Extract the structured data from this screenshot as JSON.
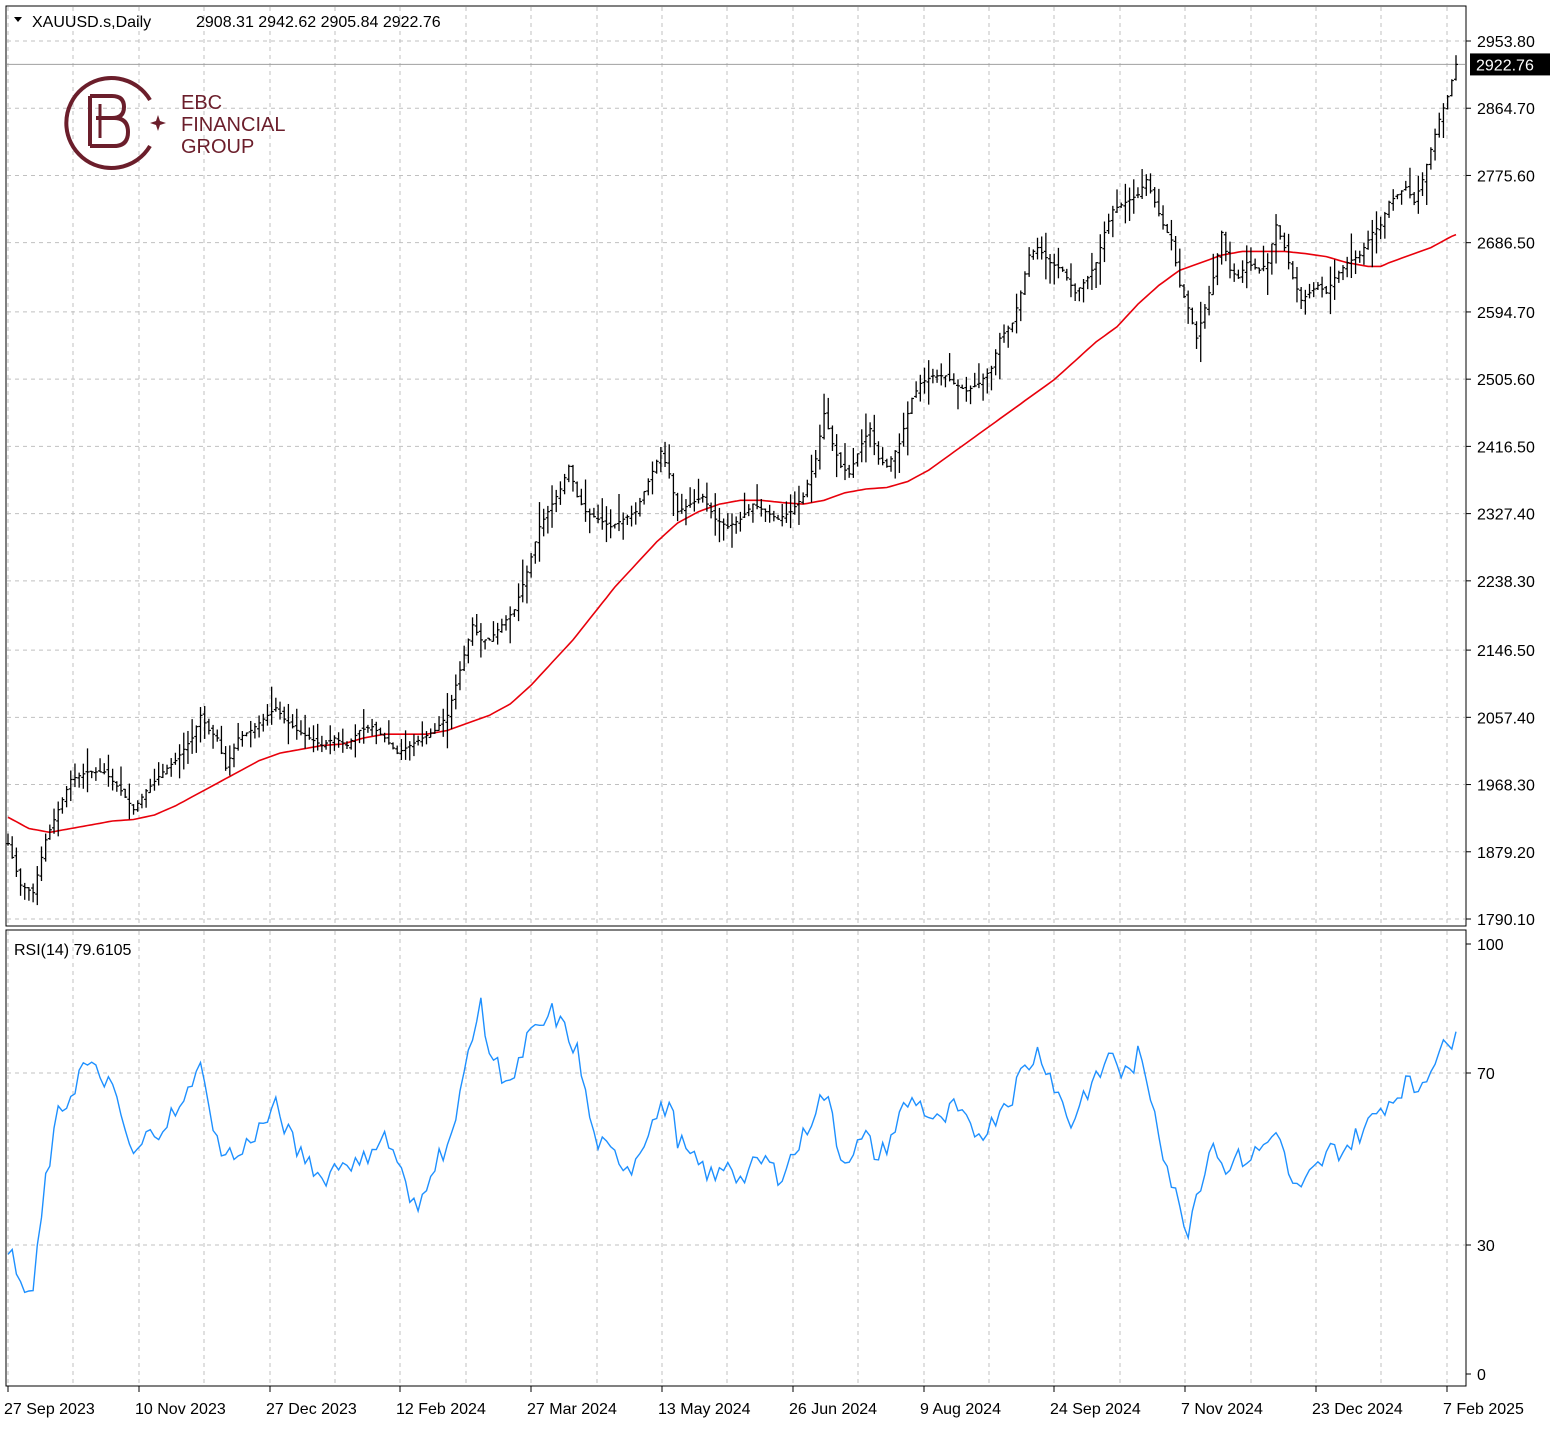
{
  "header": {
    "symbol": "XAUUSD.s,Daily",
    "ohlc": "2908.31 2942.62 2905.84 2922.76"
  },
  "logo": {
    "line1": "EBC",
    "line2": "FINANCIAL",
    "line3": "GROUP",
    "color": "#6b1e2b"
  },
  "indicator": {
    "label": "RSI(14) 79.6105"
  },
  "colors": {
    "candles": "#000000",
    "ma": "#e8000b",
    "rsi": "#1e90ff",
    "grid": "#c0c0c0",
    "last_price_bg": "#000000",
    "last_price_fg": "#ffffff"
  },
  "chart_data": [
    {
      "type": "bar",
      "title": "XAUUSD.s,Daily",
      "x_labels": [
        "27 Sep 2023",
        "10 Nov 2023",
        "27 Dec 2023",
        "12 Feb 2024",
        "27 Mar 2024",
        "13 May 2024",
        "26 Jun 2024",
        "9 Aug 2024",
        "24 Sep 2024",
        "7 Nov 2024",
        "23 Dec 2024",
        "7 Feb 2025"
      ],
      "y_ticks": [
        "2953.80",
        "2864.70",
        "2775.60",
        "2686.50",
        "2594.70",
        "2505.60",
        "2416.50",
        "2327.40",
        "2238.30",
        "2146.50",
        "2057.40",
        "1968.30",
        "1879.20",
        "1790.10"
      ],
      "ylim": [
        1790.1,
        2953.8
      ],
      "last_price": "2922.76",
      "close_series_anchors": [
        [
          0,
          1890
        ],
        [
          3,
          1835
        ],
        [
          6,
          1825
        ],
        [
          9,
          1895
        ],
        [
          12,
          1935
        ],
        [
          15,
          1975
        ],
        [
          19,
          1985
        ],
        [
          23,
          1985
        ],
        [
          27,
          1960
        ],
        [
          30,
          1935
        ],
        [
          33,
          1960
        ],
        [
          37,
          1985
        ],
        [
          40,
          2000
        ],
        [
          44,
          2030
        ],
        [
          46,
          2060
        ],
        [
          48,
          2040
        ],
        [
          50,
          2030
        ],
        [
          52,
          1990
        ],
        [
          55,
          2030
        ],
        [
          58,
          2040
        ],
        [
          62,
          2060
        ],
        [
          64,
          2070
        ],
        [
          66,
          2055
        ],
        [
          69,
          2040
        ],
        [
          72,
          2030
        ],
        [
          75,
          2020
        ],
        [
          78,
          2030
        ],
        [
          81,
          2020
        ],
        [
          84,
          2040
        ],
        [
          87,
          2045
        ],
        [
          90,
          2030
        ],
        [
          93,
          2010
        ],
        [
          96,
          2020
        ],
        [
          99,
          2030
        ],
        [
          102,
          2040
        ],
        [
          105,
          2060
        ],
        [
          108,
          2120
        ],
        [
          111,
          2180
        ],
        [
          113,
          2160
        ],
        [
          115,
          2160
        ],
        [
          118,
          2180
        ],
        [
          121,
          2200
        ],
        [
          124,
          2250
        ],
        [
          127,
          2310
        ],
        [
          129,
          2330
        ],
        [
          132,
          2360
        ],
        [
          134,
          2390
        ],
        [
          136,
          2350
        ],
        [
          138,
          2330
        ],
        [
          141,
          2320
        ],
        [
          144,
          2310
        ],
        [
          147,
          2320
        ],
        [
          150,
          2330
        ],
        [
          153,
          2370
        ],
        [
          156,
          2410
        ],
        [
          158,
          2380
        ],
        [
          160,
          2330
        ],
        [
          163,
          2340
        ],
        [
          166,
          2350
        ],
        [
          169,
          2320
        ],
        [
          172,
          2310
        ],
        [
          175,
          2320
        ],
        [
          178,
          2340
        ],
        [
          181,
          2330
        ],
        [
          184,
          2320
        ],
        [
          187,
          2330
        ],
        [
          190,
          2350
        ],
        [
          193,
          2400
        ],
        [
          195,
          2460
        ],
        [
          197,
          2420
        ],
        [
          199,
          2390
        ],
        [
          201,
          2380
        ],
        [
          204,
          2420
        ],
        [
          206,
          2440
        ],
        [
          208,
          2400
        ],
        [
          210,
          2390
        ],
        [
          213,
          2420
        ],
        [
          216,
          2480
        ],
        [
          218,
          2500
        ],
        [
          221,
          2510
        ],
        [
          224,
          2510
        ],
        [
          226,
          2500
        ],
        [
          229,
          2490
        ],
        [
          232,
          2500
        ],
        [
          235,
          2520
        ],
        [
          237,
          2560
        ],
        [
          240,
          2580
        ],
        [
          242,
          2620
        ],
        [
          244,
          2670
        ],
        [
          246,
          2680
        ],
        [
          249,
          2660
        ],
        [
          252,
          2650
        ],
        [
          255,
          2620
        ],
        [
          258,
          2640
        ],
        [
          260,
          2660
        ],
        [
          262,
          2700
        ],
        [
          264,
          2730
        ],
        [
          267,
          2740
        ],
        [
          270,
          2750
        ],
        [
          272,
          2770
        ],
        [
          274,
          2740
        ],
        [
          276,
          2710
        ],
        [
          278,
          2690
        ],
        [
          280,
          2630
        ],
        [
          282,
          2600
        ],
        [
          284,
          2560
        ],
        [
          286,
          2600
        ],
        [
          288,
          2640
        ],
        [
          290,
          2700
        ],
        [
          292,
          2650
        ],
        [
          294,
          2640
        ],
        [
          296,
          2660
        ],
        [
          299,
          2650
        ],
        [
          301,
          2660
        ],
        [
          303,
          2710
        ],
        [
          305,
          2680
        ],
        [
          307,
          2640
        ],
        [
          309,
          2610
        ],
        [
          311,
          2620
        ],
        [
          313,
          2630
        ],
        [
          315,
          2620
        ],
        [
          317,
          2640
        ],
        [
          320,
          2660
        ],
        [
          323,
          2670
        ],
        [
          326,
          2700
        ],
        [
          328,
          2710
        ],
        [
          330,
          2740
        ],
        [
          332,
          2750
        ],
        [
          334,
          2760
        ],
        [
          336,
          2740
        ],
        [
          338,
          2770
        ],
        [
          340,
          2810
        ],
        [
          342,
          2850
        ],
        [
          344,
          2880
        ],
        [
          346,
          2922.76
        ]
      ],
      "ma_series_anchors": [
        [
          0,
          1925
        ],
        [
          5,
          1910
        ],
        [
          10,
          1905
        ],
        [
          15,
          1910
        ],
        [
          20,
          1915
        ],
        [
          25,
          1920
        ],
        [
          30,
          1922
        ],
        [
          35,
          1928
        ],
        [
          40,
          1940
        ],
        [
          45,
          1955
        ],
        [
          50,
          1970
        ],
        [
          55,
          1985
        ],
        [
          60,
          2000
        ],
        [
          65,
          2010
        ],
        [
          70,
          2015
        ],
        [
          75,
          2020
        ],
        [
          80,
          2022
        ],
        [
          85,
          2030
        ],
        [
          90,
          2035
        ],
        [
          95,
          2035
        ],
        [
          100,
          2035
        ],
        [
          105,
          2040
        ],
        [
          110,
          2050
        ],
        [
          115,
          2060
        ],
        [
          120,
          2075
        ],
        [
          125,
          2100
        ],
        [
          130,
          2130
        ],
        [
          135,
          2160
        ],
        [
          140,
          2195
        ],
        [
          145,
          2230
        ],
        [
          150,
          2260
        ],
        [
          155,
          2290
        ],
        [
          160,
          2315
        ],
        [
          165,
          2330
        ],
        [
          170,
          2340
        ],
        [
          175,
          2345
        ],
        [
          180,
          2345
        ],
        [
          185,
          2342
        ],
        [
          190,
          2340
        ],
        [
          195,
          2345
        ],
        [
          200,
          2355
        ],
        [
          205,
          2360
        ],
        [
          210,
          2362
        ],
        [
          215,
          2370
        ],
        [
          220,
          2385
        ],
        [
          225,
          2405
        ],
        [
          230,
          2425
        ],
        [
          235,
          2445
        ],
        [
          240,
          2465
        ],
        [
          245,
          2485
        ],
        [
          250,
          2505
        ],
        [
          255,
          2530
        ],
        [
          260,
          2555
        ],
        [
          265,
          2575
        ],
        [
          270,
          2605
        ],
        [
          275,
          2630
        ],
        [
          280,
          2650
        ],
        [
          285,
          2660
        ],
        [
          290,
          2670
        ],
        [
          295,
          2675
        ],
        [
          300,
          2675
        ],
        [
          305,
          2675
        ],
        [
          310,
          2672
        ],
        [
          315,
          2668
        ],
        [
          320,
          2660
        ],
        [
          325,
          2655
        ],
        [
          328,
          2655
        ],
        [
          330,
          2660
        ],
        [
          335,
          2670
        ],
        [
          340,
          2680
        ],
        [
          345,
          2695
        ]
      ]
    },
    {
      "type": "line",
      "title": "RSI(14) 79.6105",
      "ylim": [
        0,
        100
      ],
      "y_ticks": [
        "100",
        "70",
        "30",
        "0"
      ],
      "series_anchors": [
        [
          0,
          30
        ],
        [
          3,
          20
        ],
        [
          6,
          19
        ],
        [
          9,
          45
        ],
        [
          12,
          60
        ],
        [
          15,
          65
        ],
        [
          18,
          72
        ],
        [
          21,
          70
        ],
        [
          24,
          68
        ],
        [
          27,
          60
        ],
        [
          30,
          50
        ],
        [
          33,
          55
        ],
        [
          36,
          57
        ],
        [
          39,
          60
        ],
        [
          42,
          62
        ],
        [
          45,
          72
        ],
        [
          47,
          70
        ],
        [
          49,
          55
        ],
        [
          52,
          52
        ],
        [
          55,
          50
        ],
        [
          58,
          55
        ],
        [
          61,
          58
        ],
        [
          64,
          62
        ],
        [
          66,
          58
        ],
        [
          69,
          52
        ],
        [
          72,
          50
        ],
        [
          75,
          45
        ],
        [
          78,
          48
        ],
        [
          81,
          50
        ],
        [
          84,
          48
        ],
        [
          87,
          53
        ],
        [
          90,
          55
        ],
        [
          93,
          50
        ],
        [
          96,
          40
        ],
        [
          98,
          38
        ],
        [
          101,
          48
        ],
        [
          104,
          52
        ],
        [
          107,
          58
        ],
        [
          109,
          70
        ],
        [
          111,
          80
        ],
        [
          113,
          85
        ],
        [
          115,
          75
        ],
        [
          118,
          70
        ],
        [
          121,
          68
        ],
        [
          124,
          78
        ],
        [
          127,
          80
        ],
        [
          130,
          84
        ],
        [
          133,
          80
        ],
        [
          136,
          75
        ],
        [
          138,
          65
        ],
        [
          140,
          55
        ],
        [
          143,
          52
        ],
        [
          146,
          50
        ],
        [
          149,
          48
        ],
        [
          152,
          55
        ],
        [
          155,
          60
        ],
        [
          158,
          63
        ],
        [
          160,
          55
        ],
        [
          163,
          50
        ],
        [
          166,
          48
        ],
        [
          169,
          45
        ],
        [
          172,
          50
        ],
        [
          175,
          45
        ],
        [
          178,
          48
        ],
        [
          181,
          50
        ],
        [
          184,
          46
        ],
        [
          187,
          50
        ],
        [
          190,
          55
        ],
        [
          193,
          62
        ],
        [
          195,
          65
        ],
        [
          197,
          60
        ],
        [
          199,
          50
        ],
        [
          202,
          52
        ],
        [
          205,
          55
        ],
        [
          208,
          50
        ],
        [
          211,
          55
        ],
        [
          214,
          62
        ],
        [
          217,
          64
        ],
        [
          220,
          60
        ],
        [
          223,
          58
        ],
        [
          226,
          62
        ],
        [
          229,
          58
        ],
        [
          232,
          56
        ],
        [
          235,
          58
        ],
        [
          237,
          62
        ],
        [
          240,
          65
        ],
        [
          242,
          70
        ],
        [
          244,
          72
        ],
        [
          246,
          75
        ],
        [
          248,
          72
        ],
        [
          251,
          65
        ],
        [
          254,
          58
        ],
        [
          257,
          65
        ],
        [
          260,
          68
        ],
        [
          262,
          72
        ],
        [
          264,
          75
        ],
        [
          266,
          70
        ],
        [
          268,
          70
        ],
        [
          270,
          74
        ],
        [
          272,
          68
        ],
        [
          274,
          62
        ],
        [
          276,
          52
        ],
        [
          278,
          45
        ],
        [
          280,
          38
        ],
        [
          282,
          34
        ],
        [
          284,
          42
        ],
        [
          286,
          48
        ],
        [
          288,
          55
        ],
        [
          290,
          48
        ],
        [
          293,
          50
        ],
        [
          296,
          50
        ],
        [
          299,
          52
        ],
        [
          302,
          55
        ],
        [
          303,
          58
        ],
        [
          305,
          50
        ],
        [
          307,
          44
        ],
        [
          309,
          42
        ],
        [
          311,
          46
        ],
        [
          313,
          48
        ],
        [
          316,
          52
        ],
        [
          319,
          52
        ],
        [
          322,
          55
        ],
        [
          325,
          58
        ],
        [
          328,
          62
        ],
        [
          331,
          64
        ],
        [
          334,
          68
        ],
        [
          336,
          66
        ],
        [
          338,
          68
        ],
        [
          340,
          72
        ],
        [
          342,
          75
        ],
        [
          344,
          76
        ],
        [
          346,
          79.61
        ]
      ]
    }
  ]
}
